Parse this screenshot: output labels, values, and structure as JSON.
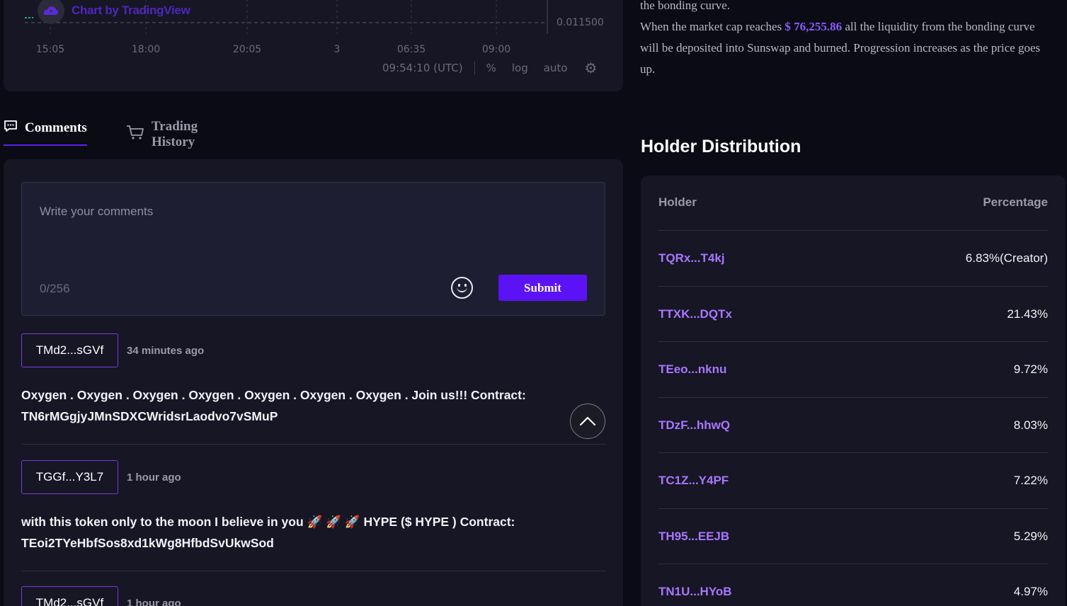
{
  "chart": {
    "watermark": "Chart by TradingView",
    "price_label": "0.011500",
    "time_ticks": [
      "15:05",
      "18:00",
      "20:05",
      "3",
      "06:35",
      "09:00"
    ],
    "toolbar": {
      "clock": "09:54:10 (UTC)",
      "percent": "%",
      "log": "log",
      "auto": "auto"
    }
  },
  "tabs": {
    "comments": "Comments",
    "trading_history": "Trading History"
  },
  "comment_form": {
    "placeholder": "Write your comments",
    "char_count": "0/256",
    "submit_label": "Submit"
  },
  "comments": [
    {
      "user": "TMd2...sGVf",
      "time": "34 minutes ago",
      "text_line1": "Oxygen . Oxygen . Oxygen . Oxygen . Oxygen . Oxygen . Oxygen . Join us!!! Contract:",
      "text_line2": "TN6rMGgjyJMnSDXCWridsrLaodvo7vSMuP"
    },
    {
      "user": "TGGf...Y3L7",
      "time": "1 hour ago",
      "text_line1": "with this token only to the moon I believe in you 🚀 🚀 🚀 HYPE ($ HYPE ) Contract:",
      "text_line2": "TEoi2TYeHbfSos8xd1kWg8HfbdSvUkwSod"
    },
    {
      "user": "TMd2...sGVf",
      "time": "1 hour ago"
    }
  ],
  "bonding": {
    "line0": "the bonding curve.",
    "line1_prefix": "When the market cap reaches ",
    "market_cap": "$ 76,255.86",
    "line1_suffix": " all the liquidity from the bonding curve",
    "line2": "will be deposited into Sunswap and burned. Progression increases as the price goes",
    "line3": "up."
  },
  "holders": {
    "title": "Holder Distribution",
    "col_holder": "Holder",
    "col_percentage": "Percentage",
    "rows": [
      {
        "address": "TQRx...T4kj",
        "percentage": "6.83%(Creator)"
      },
      {
        "address": "TTXK...DQTx",
        "percentage": "21.43%"
      },
      {
        "address": "TEeo...nknu",
        "percentage": "9.72%"
      },
      {
        "address": "TDzF...hhwQ",
        "percentage": "8.03%"
      },
      {
        "address": "TC1Z...Y4PF",
        "percentage": "7.22%"
      },
      {
        "address": "TH95...EEJB",
        "percentage": "5.29%"
      },
      {
        "address": "TN1U...HYoB",
        "percentage": "4.97%"
      }
    ]
  },
  "colors": {
    "accent": "#5b12f5",
    "link": "#a877ff",
    "panel": "#161624",
    "background": "#0b0b16"
  }
}
